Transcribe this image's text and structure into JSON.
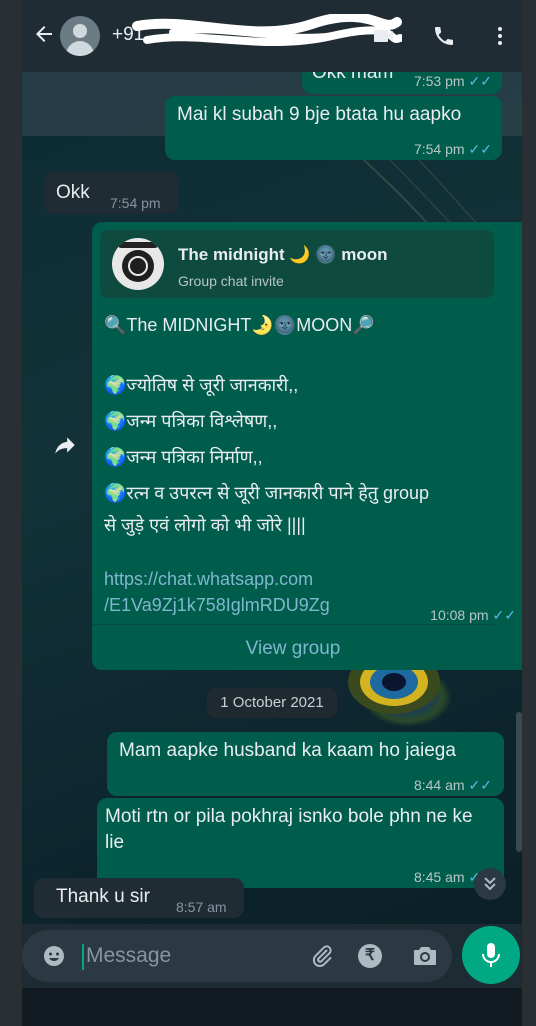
{
  "header": {
    "contact": "+91",
    "back_icon": "arrow-left-icon",
    "video_icon": "video-camera-icon",
    "call_icon": "phone-icon",
    "menu_icon": "more-vert-icon"
  },
  "messages": [
    {
      "type": "out",
      "text": "Okk mam",
      "time": "7:53 pm",
      "ticks": "✓✓"
    },
    {
      "type": "out",
      "text": "Mai kl subah 9 bje btata hu aapko",
      "time": "7:54 pm",
      "ticks": "✓✓"
    },
    {
      "type": "in",
      "text": "Okk",
      "time": "7:54 pm"
    }
  ],
  "group_card": {
    "invite_name": "The midnight 🌙 🌚 moon",
    "invite_sub": "Group chat invite",
    "lines": [
      "🔍The MIDNIGHT🌛🌚MOON🔎",
      "🌍ज्योतिष से जूरी जानकारी,,",
      "🌍जन्म पत्रिका विश्लेषण,,",
      "🌍जन्म पत्रिका निर्माण,,",
      "🌍रत्न व उपरत्न से जूरी जानकारी पाने हेतु group",
      "से जुड़े एवं लोगो को भी जोरे ||||"
    ],
    "link_line1": "https://chat.whatsapp.com",
    "link_line2": "/E1Va9Zj1k758IglmRDU9Zg",
    "time": "10:08 pm",
    "ticks": "✓✓",
    "view_group": "View group"
  },
  "date_divider": "1 October 2021",
  "messages2": [
    {
      "type": "out",
      "text": "Mam aapke husband ka kaam ho jaiega",
      "time": "8:44 am",
      "ticks": "✓✓"
    },
    {
      "type": "out",
      "text": "Moti rtn or pila pokhraj isnko bole phn ne ke lie",
      "time": "8:45 am",
      "ticks": "✓✓"
    },
    {
      "type": "in",
      "text": "Thank u sir",
      "time": "8:57 am"
    }
  ],
  "composer": {
    "placeholder": "Message",
    "rupee": "₹"
  },
  "colors": {
    "outgoing": "#005c4b",
    "incoming": "#202c33",
    "accent": "#00a884",
    "ticks": "#53bdeb"
  }
}
